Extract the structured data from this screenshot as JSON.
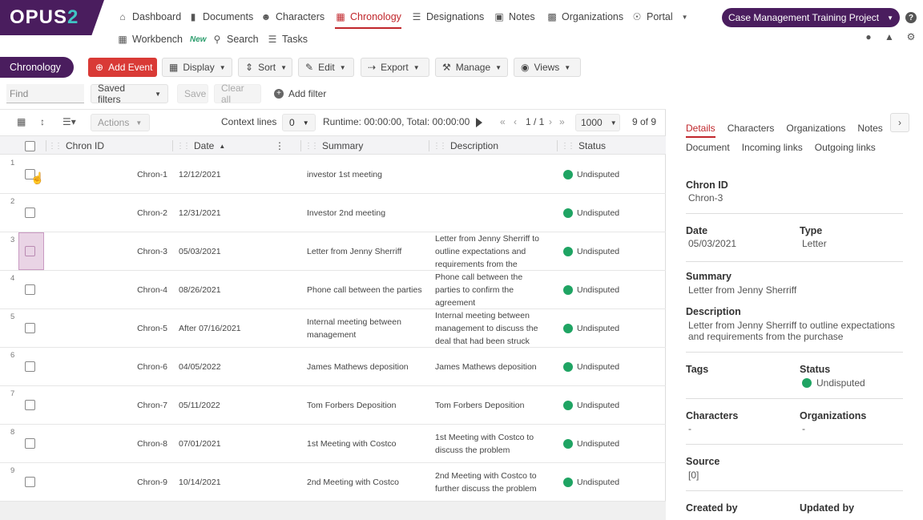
{
  "brand": {
    "logo_text": "OPUS",
    "logo_suffix": "2"
  },
  "nav": {
    "dashboard": "Dashboard",
    "documents": "Documents",
    "characters": "Characters",
    "chronology": "Chronology",
    "designations": "Designations",
    "notes": "Notes",
    "organizations": "Organizations",
    "portal": "Portal",
    "workbench": "Workbench",
    "workbench_badge": "New",
    "search": "Search",
    "tasks": "Tasks"
  },
  "project": {
    "label": "Case Management Training Project"
  },
  "toolbar": {
    "section": "Chronology",
    "add_event": "Add Event",
    "display": "Display",
    "sort": "Sort",
    "edit": "Edit",
    "export": "Export",
    "manage": "Manage",
    "views": "Views"
  },
  "filters": {
    "find_placeholder": "Find",
    "saved_filters": "Saved filters",
    "save": "Save",
    "clear_all": "Clear all",
    "add_filter": "Add filter"
  },
  "grid": {
    "actions": "Actions",
    "context_lines_label": "Context lines",
    "context_lines_value": "0",
    "runtime": "Runtime: 00:00:00, Total: 00:00:00",
    "page": "1 / 1",
    "page_size": "1000",
    "count": "9 of 9",
    "columns": {
      "chron_id": "Chron ID",
      "date": "Date",
      "summary": "Summary",
      "description": "Description",
      "status": "Status"
    },
    "rows": [
      {
        "num": "1",
        "id": "Chron-1",
        "date": "12/12/2021",
        "summary": "investor 1st meeting",
        "description": "",
        "status": "Undisputed"
      },
      {
        "num": "2",
        "id": "Chron-2",
        "date": "12/31/2021",
        "summary": "Investor 2nd meeting",
        "description": "",
        "status": "Undisputed"
      },
      {
        "num": "3",
        "id": "Chron-3",
        "date": "05/03/2021",
        "summary": "Letter from Jenny Sherriff",
        "description": "Letter from Jenny Sherriff to outline expectations and requirements from the",
        "status": "Undisputed"
      },
      {
        "num": "4",
        "id": "Chron-4",
        "date": "08/26/2021",
        "summary": "Phone call between the parties",
        "description": "Phone call between the parties to confirm the agreement",
        "status": "Undisputed"
      },
      {
        "num": "5",
        "id": "Chron-5",
        "date": "After 07/16/2021",
        "summary": "Internal meeting between management",
        "description": "Internal meeting between management to discuss the deal that had been struck",
        "status": "Undisputed"
      },
      {
        "num": "6",
        "id": "Chron-6",
        "date": "04/05/2022",
        "summary": "James Mathews deposition",
        "description": "James Mathews deposition",
        "status": "Undisputed"
      },
      {
        "num": "7",
        "id": "Chron-7",
        "date": "05/11/2022",
        "summary": "Tom Forbers Deposition",
        "description": "Tom Forbers Deposition",
        "status": "Undisputed"
      },
      {
        "num": "8",
        "id": "Chron-8",
        "date": "07/01/2021",
        "summary": "1st Meeting with Costco",
        "description": "1st Meeting with Costco to discuss the problem",
        "status": "Undisputed"
      },
      {
        "num": "9",
        "id": "Chron-9",
        "date": "10/14/2021",
        "summary": "2nd Meeting with Costco",
        "description": "2nd Meeting with Costco to further discuss the problem",
        "status": "Undisputed"
      }
    ]
  },
  "panel": {
    "tabs": [
      "Details",
      "Characters",
      "Organizations",
      "Notes"
    ],
    "subtabs": [
      "Document",
      "Incoming links",
      "Outgoing links"
    ],
    "chron_id_label": "Chron ID",
    "chron_id": "Chron-3",
    "date_label": "Date",
    "date": "05/03/2021",
    "type_label": "Type",
    "type": "Letter",
    "summary_label": "Summary",
    "summary": "Letter from Jenny Sherriff",
    "description_label": "Description",
    "description": "Letter from Jenny Sherriff to outline expectations and requirements from the purchase",
    "tags_label": "Tags",
    "status_label": "Status",
    "status": "Undisputed",
    "characters_label": "Characters",
    "characters": "-",
    "organizations_label": "Organizations",
    "organizations": "-",
    "source_label": "Source",
    "source": "[0]",
    "created_by_label": "Created by",
    "updated_by_label": "Updated by"
  },
  "colors": {
    "brand_purple": "#4a1d5e",
    "accent_red": "#c0262b",
    "add_event_red": "#d93a36",
    "status_green": "#1fa463"
  }
}
